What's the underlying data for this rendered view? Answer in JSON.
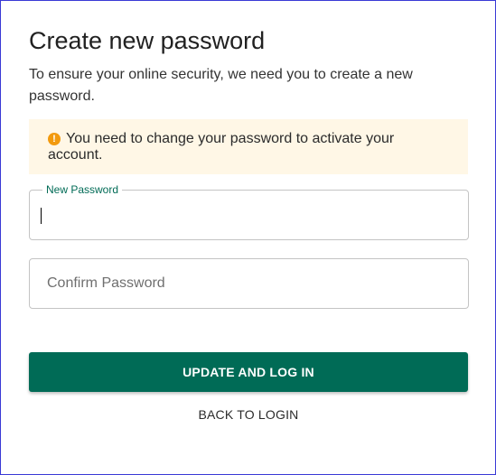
{
  "page": {
    "title": "Create new password",
    "intro": "To ensure your online security, we need you to create a new password."
  },
  "alert": {
    "icon": "warning-circle-icon",
    "icon_glyph": "!",
    "message": "You need to change your password to activate your account.",
    "background_color": "#fff7e6",
    "icon_color": "#f29a0e"
  },
  "form": {
    "new_password": {
      "label": "New Password",
      "value": ""
    },
    "confirm_password": {
      "placeholder": "Confirm Password",
      "value": ""
    }
  },
  "actions": {
    "submit_label": "UPDATE AND LOG IN",
    "back_label": "BACK TO LOGIN",
    "primary_color": "#006b56"
  }
}
